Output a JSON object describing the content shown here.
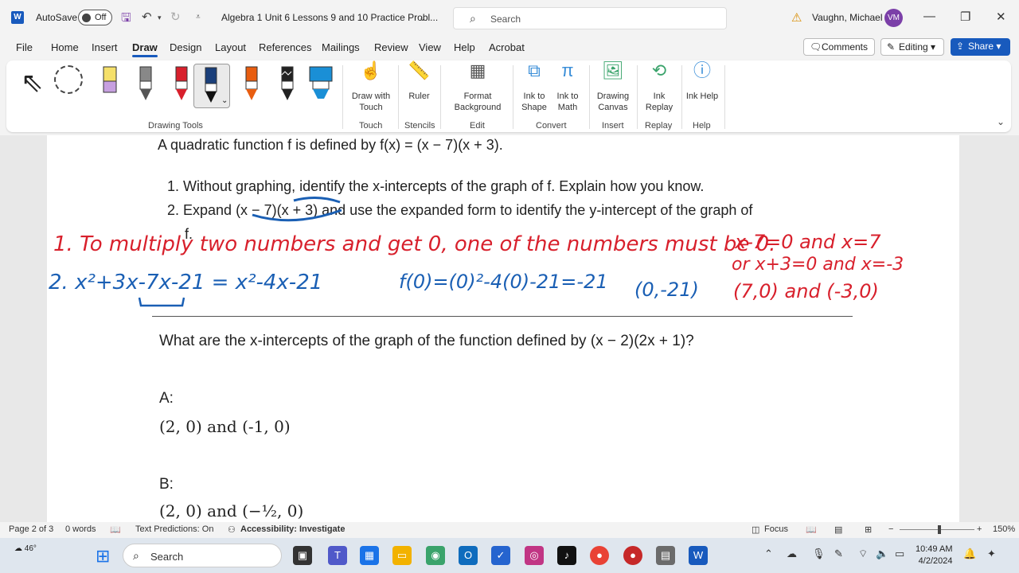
{
  "titlebar": {
    "autosave_label": "AutoSave",
    "autosave_state": "Off",
    "doc_title": "Algebra 1 Unit 6 Lessons 9 and 10 Practice Probl...",
    "search_placeholder": "Search",
    "user_name": "Vaughn, Michael",
    "user_initials": "VM"
  },
  "menu": {
    "tabs": [
      "File",
      "Home",
      "Insert",
      "Draw",
      "Design",
      "Layout",
      "References",
      "Mailings",
      "Review",
      "View",
      "Help",
      "Acrobat"
    ],
    "active_tab": "Draw",
    "comments": "Comments",
    "editing": "Editing",
    "share": "Share"
  },
  "ribbon": {
    "drawing_tools_label": "Drawing Tools",
    "draw_with_touch": "Draw with Touch",
    "touch_label": "Touch",
    "ruler": "Ruler",
    "stencils_label": "Stencils",
    "format_background": "Format Background",
    "edit_label": "Edit",
    "ink_to_shape": "Ink to Shape",
    "ink_to_math": "Ink to Math",
    "convert_label": "Convert",
    "drawing_canvas": "Drawing Canvas",
    "insert_label": "Insert",
    "ink_replay": "Ink Replay",
    "replay_label": "Replay",
    "ink_help": "Ink Help",
    "help_label": "Help",
    "pen_colors": [
      "#f5e06a",
      "#888888",
      "#d8202c",
      "#1a3f7a",
      "#e85d10",
      "#222222",
      "#1a8fd6"
    ]
  },
  "document": {
    "intro": "A quadratic function f is defined by f(x) = (x − 7)(x + 3).",
    "q1": "1. Without graphing, identify the x-intercepts of the graph of f. Explain how you know.",
    "q2": "2. Expand (x − 7)(x + 3) and use the expanded form to identify the y-intercept of the graph of",
    "q2_cont": "f.",
    "ink_line1": "1. To multiply two numbers and get 0, one of the numbers must be 0.",
    "ink_line1_right": "x-7=0 and x=7",
    "ink_line2_right": "or x+3=0 and x=-3",
    "ink_line3_right": "(7,0) and (-3,0)",
    "ink_expand_red": "2. x²+3x-7x-21 = x²-4x-21",
    "ink_expand_blue": "f(0)=(0)²-4(0)-21=-21",
    "ink_point_blue": "(0,-21)",
    "question": "What are the x-intercepts of the graph of the function defined by (x − 2)(2x + 1)?",
    "option_a_label": "A:",
    "option_a": "(2, 0) and (-1, 0)",
    "option_b_label": "B:",
    "option_b": "(2, 0) and (−½, 0)"
  },
  "status": {
    "page": "Page 2 of 3",
    "words": "0 words",
    "predictions": "Text Predictions: On",
    "accessibility": "Accessibility: Investigate",
    "focus": "Focus",
    "zoom": "150%"
  },
  "taskbar": {
    "weather": "46°",
    "search": "Search",
    "time": "10:49 AM",
    "date": "4/2/2024"
  }
}
